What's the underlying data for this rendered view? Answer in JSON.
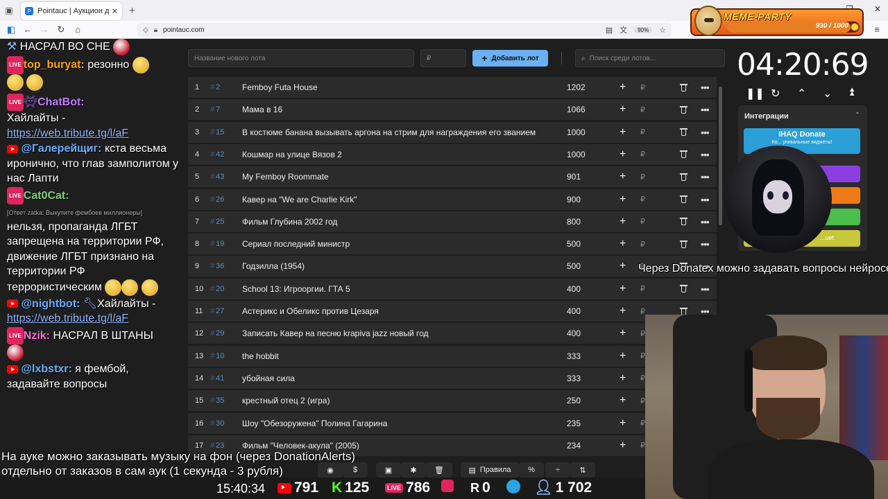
{
  "browser": {
    "tab_title": "Pointauc | Аукцион для стрим",
    "url": "pointauc.com",
    "zoom": "90%"
  },
  "meme_party": {
    "title": "MEME-PARTY",
    "progress_text": "930 / 1000",
    "progress_fraction": 0.93
  },
  "chat": {
    "line1": "НАСРАЛ ВО СНЕ",
    "m1_user": "top_buryat:",
    "m1_text": " резонно",
    "m2_user": "ChatBot:",
    "m2_text": "Хайлайты -",
    "m2_link": "https://web.tribute.tg/l/aF",
    "m3_user": "@Галерейщиг:",
    "m3_text": " кста весьма иронично, что глав замполитом у нас Лапти",
    "m4_user": "Cat0Cat:",
    "m4_reply": "[Ответ zatka: Выкупите фембоев миллионеры]",
    "m4_text": "нельзя, пропаганда ЛГБТ запрещена на территории РФ, движение ЛГБТ признано на территории РФ террористическим",
    "m5_user": "@nightbot:",
    "m5_text": "Хайлайты -",
    "m5_link": "https://web.tribute.tg/l/aF",
    "m6_user": "Nzik:",
    "m6_text": " НАСРАЛ В ШТАНЫ",
    "m7_user": "@lxbstxr:",
    "m7_text": " я фембой, задавайте вопросы"
  },
  "auction": {
    "new_lot_placeholder": "Название нового лота",
    "amount_placeholder": "₽",
    "add_button": "Добавить лот",
    "search_placeholder": "Поиск среди лотов...",
    "currency": "₽",
    "lots": [
      {
        "idx": "1",
        "num": "2",
        "name": "Femboy Futa House",
        "amount": "1202"
      },
      {
        "idx": "2",
        "num": "7",
        "name": "Мама в 16",
        "amount": "1066"
      },
      {
        "idx": "3",
        "num": "15",
        "name": "В костюме банана вызывать аргона на стрим для награждения его званием",
        "amount": "1000"
      },
      {
        "idx": "4",
        "num": "42",
        "name": "Кошмар на улице Вязов 2",
        "amount": "1000"
      },
      {
        "idx": "5",
        "num": "43",
        "name": "My Femboy Roommate",
        "amount": "901"
      },
      {
        "idx": "6",
        "num": "26",
        "name": "Кавер на \"We are Charlie Kirk\"",
        "amount": "900"
      },
      {
        "idx": "7",
        "num": "25",
        "name": "Фильм Глубина 2002 год",
        "amount": "800"
      },
      {
        "idx": "8",
        "num": "19",
        "name": "Сериал последний министр",
        "amount": "500"
      },
      {
        "idx": "9",
        "num": "36",
        "name": "Годзилла (1954)",
        "amount": "500"
      },
      {
        "idx": "10",
        "num": "20",
        "name": "School 13: Игрооргии. ГТА 5",
        "amount": "400"
      },
      {
        "idx": "11",
        "num": "27",
        "name": "Астерикс и Обеликс против Цезаря",
        "amount": "400"
      },
      {
        "idx": "12",
        "num": "29",
        "name": "Записать Кавер на песню krapiva jazz новый год",
        "amount": "400"
      },
      {
        "idx": "13",
        "num": "10",
        "name": "the hobbit",
        "amount": "333"
      },
      {
        "idx": "14",
        "num": "41",
        "name": "убойная сила",
        "amount": "333"
      },
      {
        "idx": "15",
        "num": "35",
        "name": "крестный отец 2 (игра)",
        "amount": "250"
      },
      {
        "idx": "16",
        "num": "30",
        "name": "Шоу \"Обезоружена\" Полина Гагарина",
        "amount": "235"
      },
      {
        "idx": "17",
        "num": "23",
        "name": "Фильм \"Человек-акула\" (2005)",
        "amount": "234"
      }
    ]
  },
  "timer": {
    "value": "04:20:69"
  },
  "integrations": {
    "title": "Интеграции",
    "ihaq": "IHAQ Donate",
    "ihaq_sub": "Ко... уникальные виджеты!",
    "btn_last": "...uet"
  },
  "overlay": {
    "donatex_text": "Через Donatex можно задавать вопросы нейросети",
    "music_line1": "На ауке можно заказывать музыку на фон (через DonationAlerts)",
    "music_line2": "отдельно от заказов в сам аук (1 секунда - 3 рубля)"
  },
  "toolbar": {
    "rules": "Правила"
  },
  "stats": {
    "time": "15:40:34",
    "youtube": "791",
    "kick": "125",
    "vk": "786",
    "rutube": "0",
    "total": "1 702"
  }
}
